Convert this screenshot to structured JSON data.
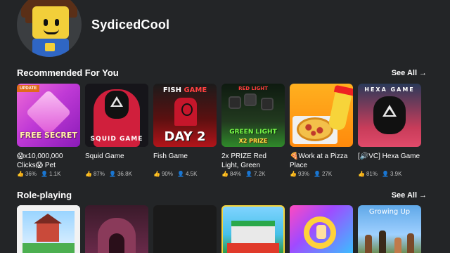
{
  "profile": {
    "username": "SydicedCool"
  },
  "sections": [
    {
      "title": "Recommended For You",
      "see_all": "See All",
      "games": [
        {
          "title": "😱x10,000,000 Clicks😱 Pet",
          "thumb_text": "FREE SECRET",
          "tag": "UPDATE",
          "rating": "36%",
          "players": "1.1K"
        },
        {
          "title": "Squid Game",
          "thumb_text": "SQUID GAME",
          "rating": "87%",
          "players": "36.8K"
        },
        {
          "title": "Fish Game",
          "thumb_text_top_a": "FISH",
          "thumb_text_top_b": "GAME",
          "thumb_text": "DAY 2",
          "rating": "90%",
          "players": "4.5K"
        },
        {
          "title": "2x PRIZE Red Light, Green",
          "thumb_text_top": "RED LIGHT",
          "thumb_text_mid": "GREEN LIGHT",
          "thumb_text": "X2 PRIZE",
          "rating": "84%",
          "players": "7.2K"
        },
        {
          "title": "🍕Work at a Pizza Place",
          "rating": "93%",
          "players": "27K"
        },
        {
          "title": "[🔊VC] Hexa Game",
          "thumb_text": "HEXA GAME",
          "rating": "81%",
          "players": "3.9K"
        }
      ]
    },
    {
      "title": "Role-playing",
      "see_all": "See All",
      "games": [
        {
          "title": ""
        },
        {
          "title": ""
        },
        {
          "title": ""
        },
        {
          "title": ""
        },
        {
          "title": ""
        },
        {
          "title": "",
          "thumb_text": "Growing Up"
        }
      ]
    }
  ],
  "colors": {
    "background": "#232527",
    "text": "#ffffff",
    "subtext": "#bdbebe"
  },
  "icons": {
    "rating": "thumbs-up-icon",
    "players": "person-icon",
    "see_all": "chevron-right-icon"
  }
}
